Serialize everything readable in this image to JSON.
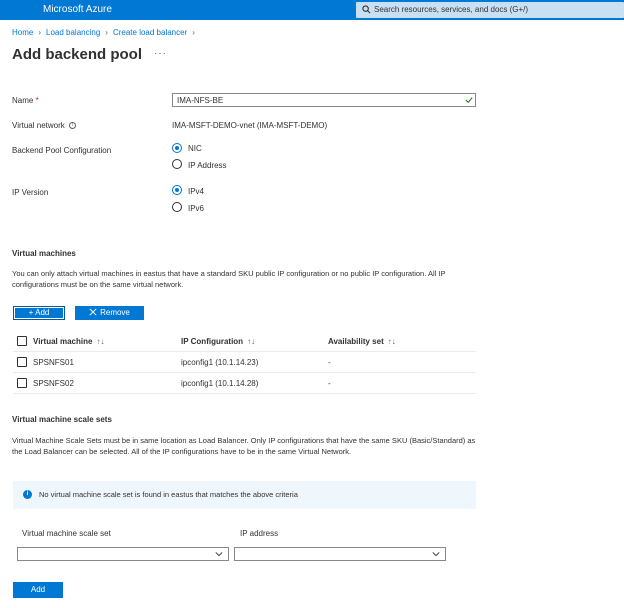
{
  "topbar": {
    "brand": "Microsoft Azure",
    "search_placeholder": "Search resources, services, and docs (G+/)"
  },
  "breadcrumb": {
    "items": [
      "Home",
      "Load balancing",
      "Create load balancer"
    ]
  },
  "page": {
    "title": "Add backend pool",
    "more": "···"
  },
  "form": {
    "name_label": "Name",
    "name_required": "*",
    "name_value": "IMA-NFS-BE",
    "vnet_label": "Virtual network",
    "vnet_value": "IMA-MSFT-DEMO-vnet (IMA-MSFT-DEMO)",
    "pool_config_label": "Backend Pool Configuration",
    "pool_config_options": [
      "NIC",
      "IP Address"
    ],
    "pool_config_selected": "NIC",
    "ip_version_label": "IP Version",
    "ip_version_options": [
      "IPv4",
      "IPv6"
    ],
    "ip_version_selected": "IPv4"
  },
  "vms": {
    "heading": "Virtual machines",
    "description": "You can only attach virtual machines in eastus that have a standard SKU public IP configuration or no public IP configuration. All IP configurations must be on the same virtual network.",
    "add_label": "+ Add",
    "remove_label": "Remove",
    "columns": [
      "Virtual machine",
      "IP Configuration",
      "Availability set"
    ],
    "sort_glyph": "↑↓",
    "rows": [
      {
        "vm": "SPSNFS01",
        "ip": "ipconfig1 (10.1.14.23)",
        "avset": "-"
      },
      {
        "vm": "SPSNFS02",
        "ip": "ipconfig1 (10.1.14.28)",
        "avset": "-"
      }
    ]
  },
  "vmss": {
    "heading": "Virtual machine scale sets",
    "description": "Virtual Machine Scale Sets must be in same location as Load Balancer. Only IP configurations that have the same SKU (Basic/Standard) as the Load Balancer can be selected. All of the IP configurations have to be in the same Virtual Network.",
    "info_message": "No virtual machine scale set is found in eastus that matches the above criteria",
    "col_vmss": "Virtual machine scale set",
    "col_ip": "IP address"
  },
  "footer": {
    "add_label": "Add"
  },
  "colors": {
    "accent": "#0078d4",
    "topbar": "#0078d4",
    "search_bg": "#c7e0f4",
    "info_bg": "#eff6fc",
    "required": "#a4262c"
  }
}
